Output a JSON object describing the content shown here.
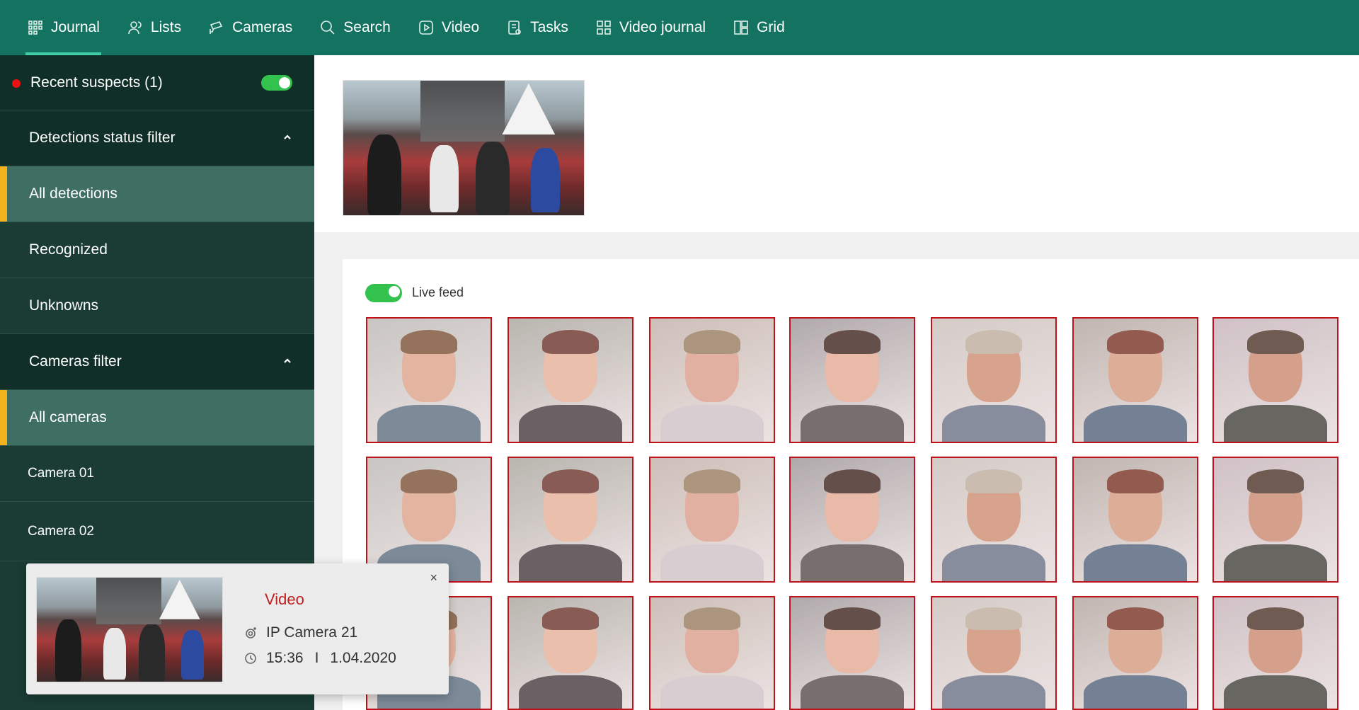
{
  "nav": [
    {
      "label": "Journal",
      "icon": "grid-dots-icon",
      "active": true
    },
    {
      "label": "Lists",
      "icon": "users-icon"
    },
    {
      "label": "Cameras",
      "icon": "cctv-camera-icon"
    },
    {
      "label": "Search",
      "icon": "search-icon"
    },
    {
      "label": "Video",
      "icon": "play-icon"
    },
    {
      "label": "Tasks",
      "icon": "tasks-icon"
    },
    {
      "label": "Video journal",
      "icon": "tiles-icon"
    },
    {
      "label": "Grid",
      "icon": "grid-layout-icon"
    }
  ],
  "sidebar": {
    "suspects": "Recent suspects (1)",
    "detections_filter": "Detections status filter",
    "detections": [
      "All detections",
      "Recognized",
      "Unknowns"
    ],
    "cameras_filter": "Cameras filter",
    "cameras": [
      "All cameras",
      "Camera 01",
      "Camera 02"
    ]
  },
  "feed": {
    "live_label": "Live feed"
  },
  "popup": {
    "title": "Video",
    "camera": "IP Camera 21",
    "time": "15:36",
    "separator": "I",
    "date": "1.04.2020",
    "close": "×"
  },
  "colors": {
    "nav": "#147360",
    "sidebar": "#1a3c34",
    "accent": "#f2b21b",
    "toggle": "#33c24e",
    "alert": "#c0121a"
  }
}
